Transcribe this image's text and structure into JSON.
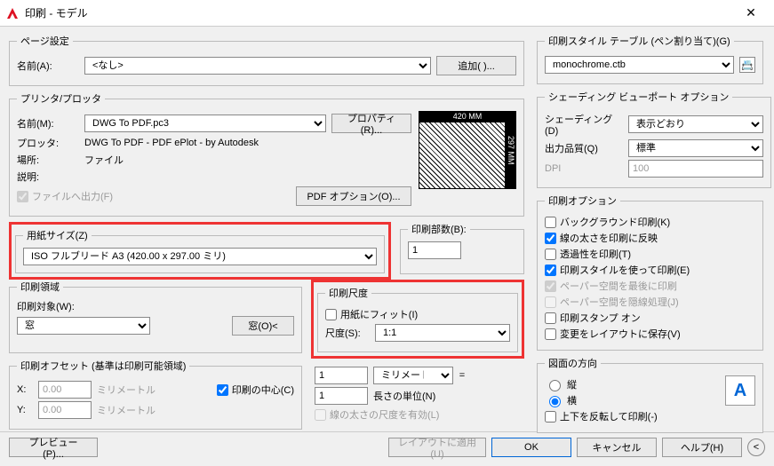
{
  "window": {
    "title": "印刷 - モデル"
  },
  "page_setup": {
    "legend": "ページ設定",
    "name_label": "名前(A):",
    "name_value": "<なし>",
    "add_btn": "追加( )..."
  },
  "printer": {
    "legend": "プリンタ/プロッタ",
    "name_label": "名前(M):",
    "name_value": "DWG To PDF.pc3",
    "prop_btn": "プロパティ(R)...",
    "plotter_label": "プロッタ:",
    "plotter_value": "DWG To PDF - PDF ePlot - by Autodesk",
    "where_label": "場所:",
    "where_value": "ファイル",
    "desc_label": "説明:",
    "to_file": "ファイルへ出力(F)",
    "pdf_opt_btn": "PDF オプション(O)...",
    "preview_w": "420 MM",
    "preview_h": "297 MM"
  },
  "paper": {
    "legend": "用紙サイズ(Z)",
    "value": "ISO フルブリード A3 (420.00 x 297.00 ミリ)"
  },
  "copies": {
    "legend": "印刷部数(B):",
    "value": "1"
  },
  "area": {
    "legend": "印刷領域",
    "target_label": "印刷対象(W):",
    "target_value": "窓",
    "window_btn": "窓(O)<"
  },
  "scale": {
    "legend": "印刷尺度",
    "fit": "用紙にフィット(I)",
    "scale_label": "尺度(S):",
    "scale_value": "1:1",
    "num1": "1",
    "unit": "ミリメートル",
    "eq": "=",
    "num2": "1",
    "unit2": "長さの単位(N)",
    "lw": "線の太さの尺度を有効(L)"
  },
  "offset": {
    "legend": "印刷オフセット (基準は印刷可能領域)",
    "x_label": "X:",
    "x_val": "0.00",
    "x_unit": "ミリメートル",
    "y_label": "Y:",
    "y_val": "0.00",
    "y_unit": "ミリメートル",
    "center": "印刷の中心(C)"
  },
  "style": {
    "legend": "印刷スタイル テーブル (ペン割り当て)(G)",
    "value": "monochrome.ctb"
  },
  "shade": {
    "legend": "シェーディング ビューポート オプション",
    "shading_label": "シェーディング(D)",
    "shading_value": "表示どおり",
    "quality_label": "出力品質(Q)",
    "quality_value": "標準",
    "dpi_label": "DPI",
    "dpi_value": "100"
  },
  "options": {
    "legend": "印刷オプション",
    "bg": "バックグラウンド印刷(K)",
    "lw": "線の太さを印刷に反映",
    "trans": "透過性を印刷(T)",
    "ps": "印刷スタイルを使って印刷(E)",
    "last": "ペーパー空間を最後に印刷",
    "hide": "ペーパー空間を隠線処理(J)",
    "stamp": "印刷スタンプ オン",
    "save": "変更をレイアウトに保存(V)"
  },
  "orient": {
    "legend": "図面の方向",
    "portrait": "縦",
    "landscape": "横",
    "upside": "上下を反転して印刷(-)"
  },
  "bottom": {
    "preview": "プレビュー(P)...",
    "apply": "レイアウトに適用(U)",
    "ok": "OK",
    "cancel": "キャンセル",
    "help": "ヘルプ(H)"
  }
}
